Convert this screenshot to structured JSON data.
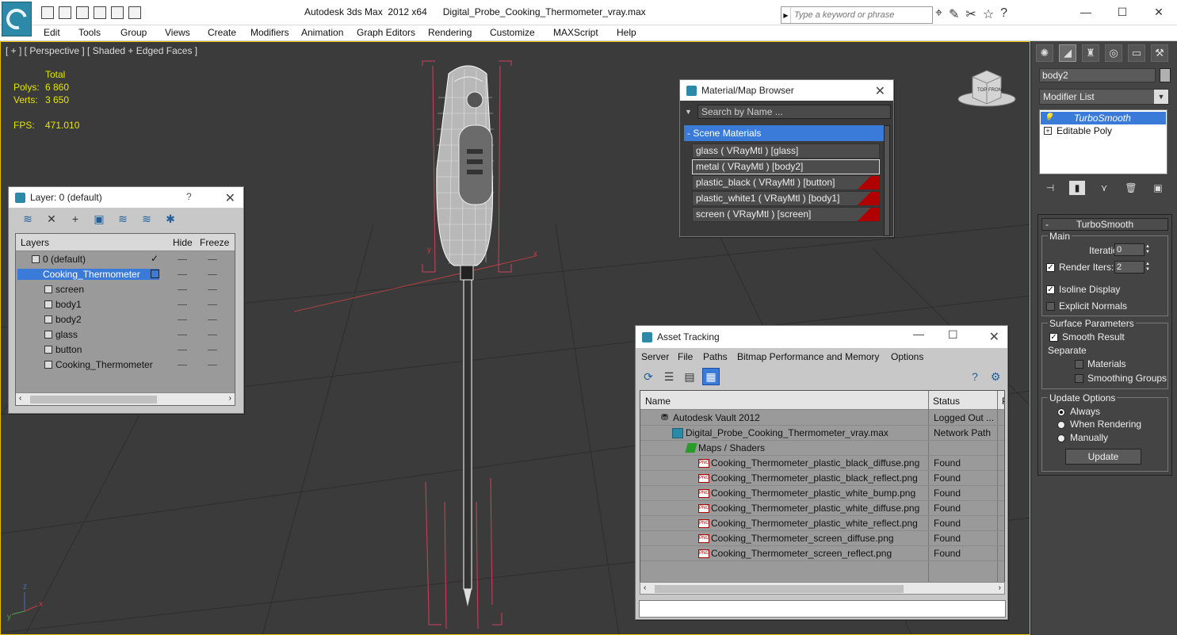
{
  "title_bar": {
    "app_title": "Autodesk 3ds Max  2012 x64      Digital_Probe_Cooking_Thermometer_vray.max",
    "search_placeholder": "Type a keyword or phrase"
  },
  "menu": {
    "items": [
      "Edit",
      "Tools",
      "Group",
      "Views",
      "Create",
      "Modifiers",
      "Animation",
      "Graph Editors",
      "Rendering",
      "Customize",
      "MAXScript",
      "Help"
    ]
  },
  "viewport": {
    "label": "[ + ] [ Perspective ] [ Shaded + Edged Faces ]",
    "stats": {
      "total_label": "Total",
      "polys_label": "Polys:",
      "polys_value": "6 860",
      "verts_label": "Verts:",
      "verts_value": "3 650",
      "fps_label": "FPS:",
      "fps_value": "471.010"
    },
    "gizmo_top": "TOP",
    "gizmo_front": "FRONT",
    "axis_x": "x",
    "axis_y": "y",
    "axis_z": "z"
  },
  "layer_dialog": {
    "title": "Layer: 0 (default)",
    "help": "?",
    "columns": {
      "layers": "Layers",
      "hide": "Hide",
      "freeze": "Freeze"
    },
    "rows": [
      {
        "name": "0 (default)"
      },
      {
        "name": "Cooking_Thermometer"
      },
      {
        "name": "screen"
      },
      {
        "name": "body1"
      },
      {
        "name": "body2"
      },
      {
        "name": "glass"
      },
      {
        "name": "button"
      },
      {
        "name": "Cooking_Thermometer"
      }
    ]
  },
  "material_browser": {
    "title": "Material/Map Browser",
    "search_placeholder": "Search by Name ...",
    "group": "- Scene Materials",
    "materials": [
      "glass  ( VRayMtl )  [glass]",
      "metal  ( VRayMtl )  [body2]",
      "plastic_black  ( VRayMtl )  [button]",
      "plastic_white1  ( VRayMtl )  [body1]",
      "screen  ( VRayMtl )  [screen]"
    ]
  },
  "asset_tracking": {
    "title": "Asset Tracking",
    "menu": [
      "Server",
      "File",
      "Paths",
      "Bitmap Performance and Memory",
      "Options"
    ],
    "columns": {
      "name": "Name",
      "status": "Status",
      "extra": "P"
    },
    "icon_text": "PNG",
    "rows": [
      {
        "name": "Autodesk Vault 2012",
        "status": "Logged Out ..."
      },
      {
        "name": "Digital_Probe_Cooking_Thermometer_vray.max",
        "status": "Network Path"
      },
      {
        "name": "Maps / Shaders",
        "status": ""
      },
      {
        "name": "Cooking_Thermometer_plastic_black_diffuse.png",
        "status": "Found"
      },
      {
        "name": "Cooking_Thermometer_plastic_black_reflect.png",
        "status": "Found"
      },
      {
        "name": "Cooking_Thermometer_plastic_white_bump.png",
        "status": "Found"
      },
      {
        "name": "Cooking_Thermometer_plastic_white_diffuse.png",
        "status": "Found"
      },
      {
        "name": "Cooking_Thermometer_plastic_white_reflect.png",
        "status": "Found"
      },
      {
        "name": "Cooking_Thermometer_screen_diffuse.png",
        "status": "Found"
      },
      {
        "name": "Cooking_Thermometer_screen_reflect.png",
        "status": "Found"
      }
    ]
  },
  "command_panel": {
    "object_name": "body2",
    "modifier_list": "Modifier List",
    "stack": [
      "TurboSmooth",
      "Editable Poly"
    ],
    "rollout_title": "TurboSmooth",
    "rollout_minus": "-",
    "main_group": "Main",
    "iterations_label": "Iterations:",
    "iterations_value": "0",
    "render_iters_label": "Render Iters:",
    "render_iters_value": "2",
    "isoline_label": "Isoline Display",
    "explicit_normals_label": "Explicit Normals",
    "surface_group": "Surface Parameters",
    "smooth_result_label": "Smooth Result",
    "separate_label": "Separate",
    "materials_label": "Materials",
    "smoothing_groups_label": "Smoothing Groups",
    "update_group": "Update Options",
    "always_label": "Always",
    "when_rendering_label": "When Rendering",
    "manually_label": "Manually",
    "update_button": "Update"
  }
}
